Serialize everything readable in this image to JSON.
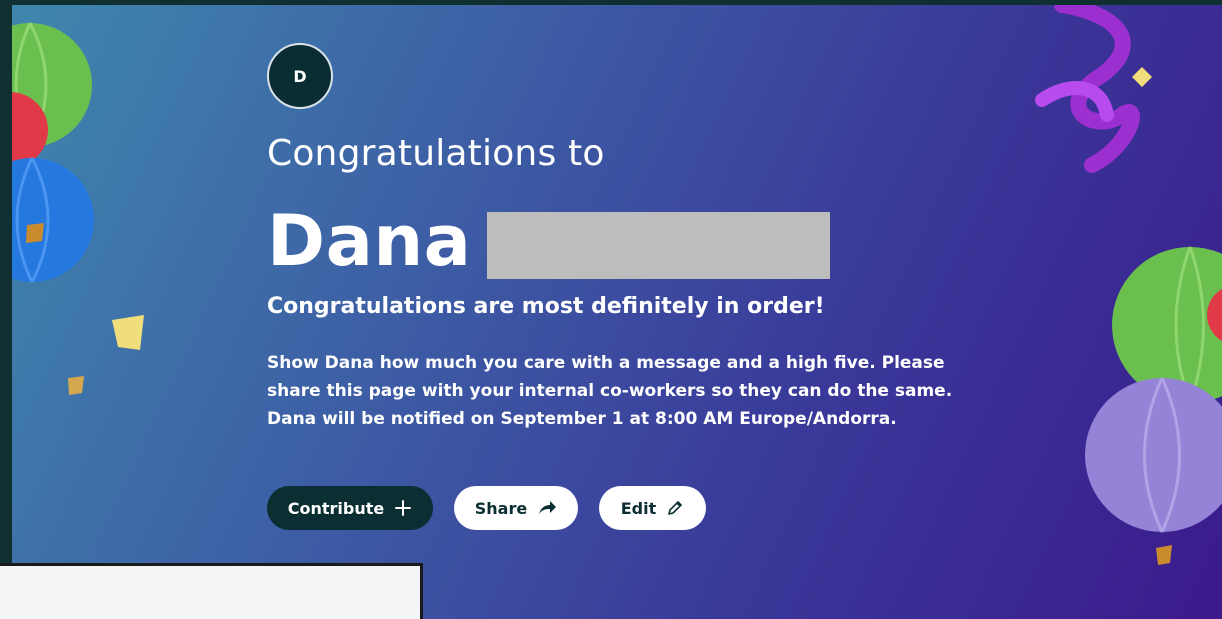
{
  "hero": {
    "avatar_initial": "D",
    "heading": "Congratulations to",
    "recipient_first_name": "Dana",
    "subheading": "Congratulations are most definitely in order!",
    "body_lines": [
      "Show Dana how much you care with a message and a high five. Please",
      "share this page with your internal co-workers so they can do the same.",
      "Dana will be notified on September 1 at 8:00 AM Europe/Andorra."
    ]
  },
  "actions": {
    "contribute_label": "Contribute",
    "share_label": "Share",
    "edit_label": "Edit"
  },
  "icons": {
    "contribute": "plus-icon",
    "share": "share-arrow-icon",
    "edit": "pencil-icon"
  },
  "colors": {
    "primary_button": "#0b2e33",
    "gradient_start": "#3f87ad",
    "gradient_end": "#3b1a8c"
  }
}
